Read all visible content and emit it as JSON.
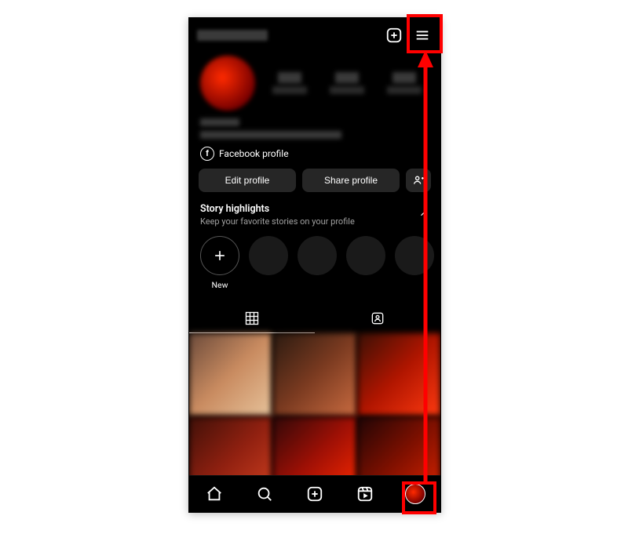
{
  "header": {
    "create_label": "Create",
    "menu_label": "Menu"
  },
  "fb_link": {
    "label": "Facebook profile"
  },
  "buttons": {
    "edit": "Edit profile",
    "share": "Share profile",
    "discover": "Discover people"
  },
  "highlights": {
    "title": "Story highlights",
    "subtitle": "Keep your favorite stories on your profile",
    "new_label": "New"
  },
  "tabs": {
    "grid": "Posts grid",
    "tagged": "Tagged"
  },
  "bottom_nav": {
    "home": "Home",
    "search": "Search",
    "create": "Create",
    "reels": "Reels",
    "profile": "Profile"
  },
  "annotation": {
    "target_top": "hamburger menu",
    "target_bottom": "profile tab"
  }
}
